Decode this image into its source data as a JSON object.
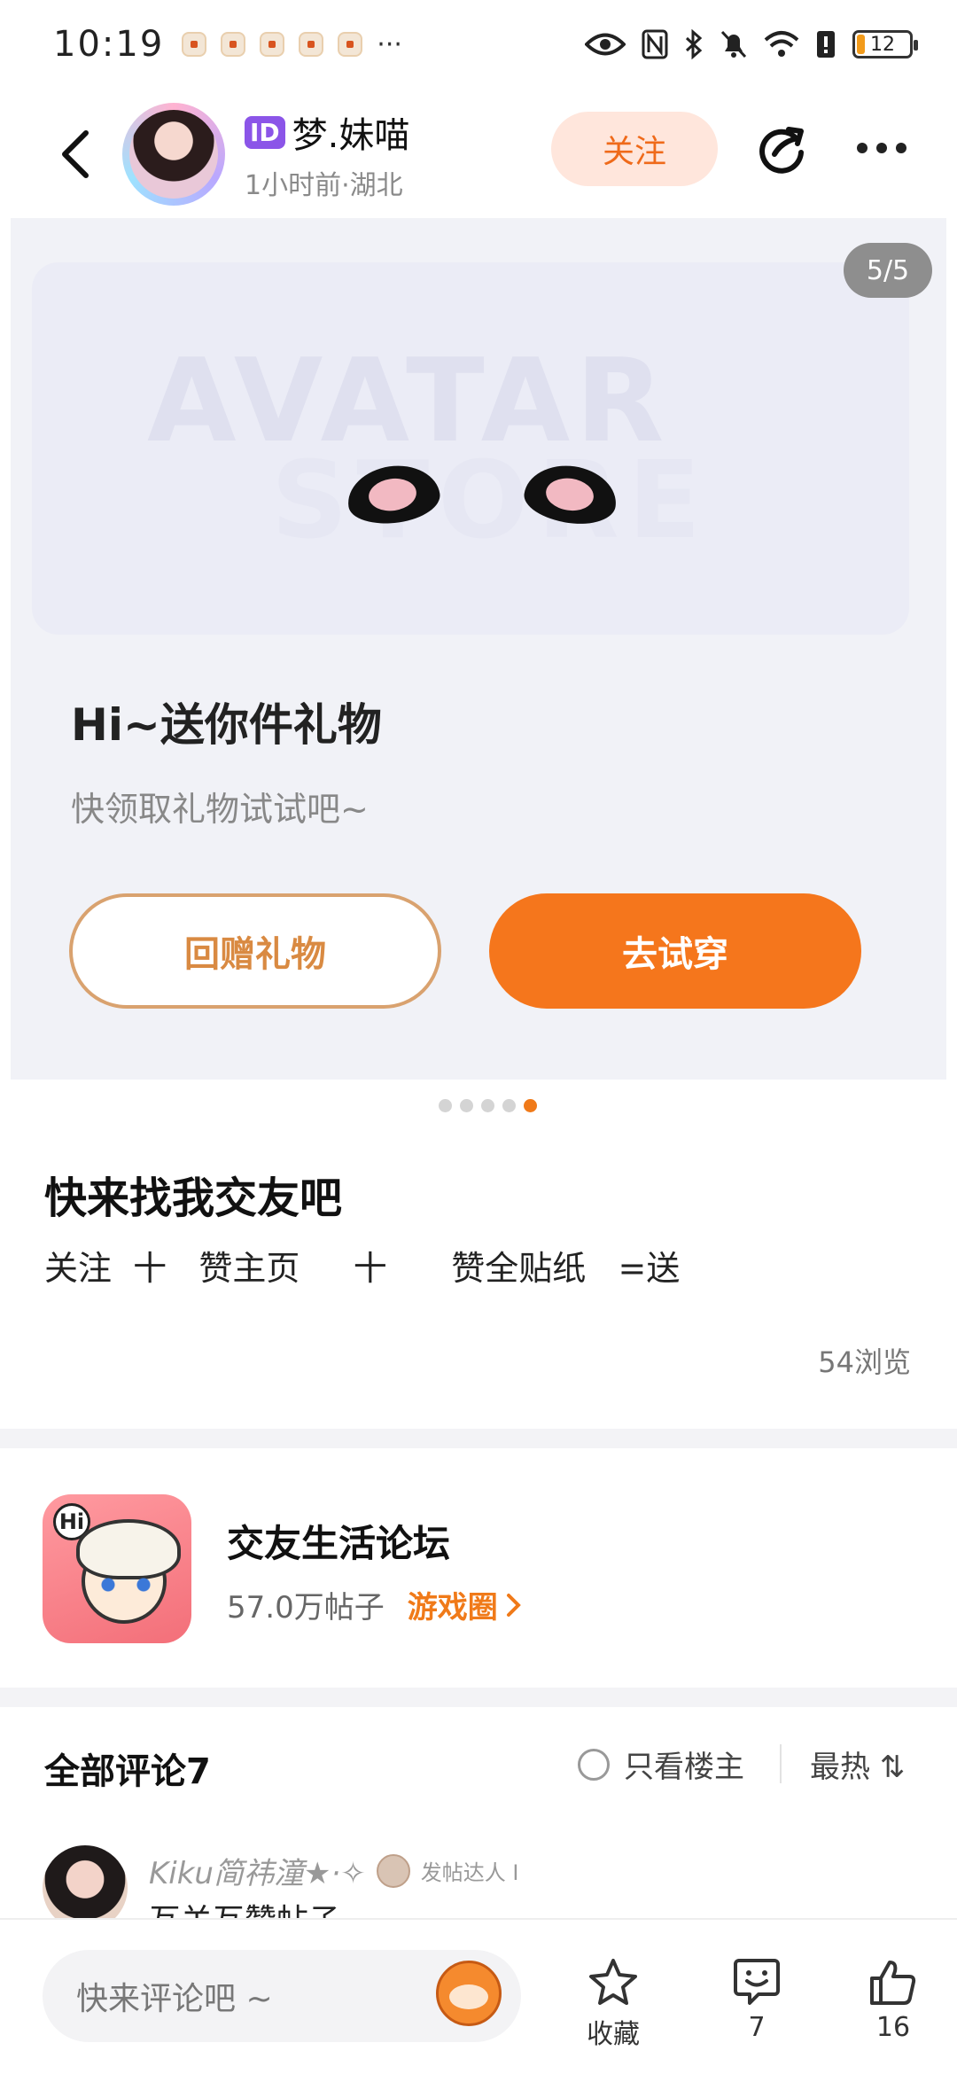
{
  "status_bar": {
    "time": "10:19",
    "more": "···",
    "battery": "12"
  },
  "header": {
    "id_badge": "ID",
    "author_name": "梦.妹喵",
    "meta": "1小时前·湖北",
    "follow_label": "关注"
  },
  "image": {
    "counter": "5/5",
    "gift_title": "Hi~送你件礼物",
    "gift_subtitle": "快领取礼物试试吧~",
    "return_gift_label": "回赠礼物",
    "try_on_label": "去试穿",
    "dots_total": 5,
    "dots_active": 5
  },
  "post": {
    "title": "快来找我交友吧",
    "body": "关注  十   赞主页     十      赞全贴纸   =送",
    "views": "54浏览"
  },
  "forum": {
    "icon_text": "Hi",
    "name": "交友生活论坛",
    "count": "57.0万帖子",
    "tag": "游戏圈"
  },
  "comments": {
    "title": "全部评论7",
    "only_op_label": "只看楼主",
    "sort_label": "最热 ⇅",
    "first": {
      "user": "Kiku简祎潼★·✧",
      "badge": "发帖达人 I",
      "text": "互关互赞帖子"
    }
  },
  "bottom_bar": {
    "input_placeholder": "快来评论吧 ~",
    "favorite_label": "收藏",
    "comment_count": "7",
    "like_count": "16"
  },
  "colors": {
    "accent": "#f5761c",
    "follow_bg": "#ffe6dc",
    "id_badge": "#8b55e8"
  }
}
